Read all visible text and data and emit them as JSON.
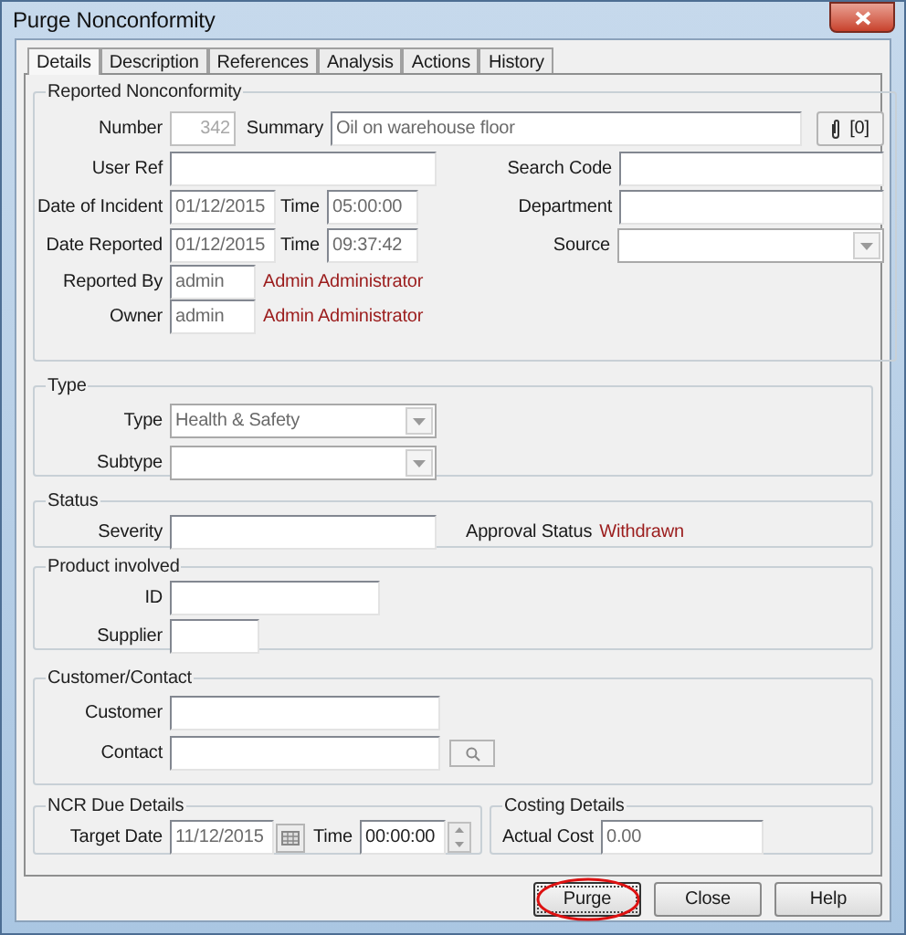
{
  "window": {
    "title": "Purge Nonconformity"
  },
  "tabs": [
    {
      "label": "Details",
      "selected": true
    },
    {
      "label": "Description",
      "selected": false
    },
    {
      "label": "References",
      "selected": false
    },
    {
      "label": "Analysis",
      "selected": false
    },
    {
      "label": "Actions",
      "selected": false
    },
    {
      "label": "History",
      "selected": false
    }
  ],
  "reported": {
    "legend": "Reported Nonconformity",
    "number": {
      "label": "Number",
      "value": "342"
    },
    "summary": {
      "label": "Summary",
      "value": "Oil on warehouse floor"
    },
    "attachments": "[0]",
    "user_ref": {
      "label": "User Ref"
    },
    "search_code": {
      "label": "Search Code"
    },
    "date_of_incident": {
      "label": "Date of Incident",
      "value": "01/12/2015"
    },
    "incident_time": {
      "label": "Time",
      "value": "05:00:00"
    },
    "department": {
      "label": "Department"
    },
    "date_reported": {
      "label": "Date Reported",
      "value": "01/12/2015"
    },
    "reported_time": {
      "label": "Time",
      "value": "09:37:42"
    },
    "source": {
      "label": "Source"
    },
    "reported_by": {
      "label": "Reported By",
      "value": "admin",
      "full_name": "Admin Administrator"
    },
    "owner": {
      "label": "Owner",
      "value": "admin",
      "full_name": "Admin Administrator"
    }
  },
  "type": {
    "legend": "Type",
    "type": {
      "label": "Type",
      "value": "Health & Safety"
    },
    "subtype": {
      "label": "Subtype"
    }
  },
  "status": {
    "legend": "Status",
    "severity": {
      "label": "Severity"
    },
    "approval_status": {
      "label": "Approval Status",
      "value": "Withdrawn"
    }
  },
  "product": {
    "legend": "Product involved",
    "id": {
      "label": "ID"
    },
    "supplier": {
      "label": "Supplier"
    }
  },
  "customer_contact": {
    "legend": "Customer/Contact",
    "customer": {
      "label": "Customer"
    },
    "contact": {
      "label": "Contact"
    }
  },
  "ncr_due": {
    "legend": "NCR Due Details",
    "target_date": {
      "label": "Target Date",
      "value": "11/12/2015"
    },
    "time": {
      "label": "Time",
      "value": "00:00:00"
    }
  },
  "costing": {
    "legend": "Costing Details",
    "actual_cost": {
      "label": "Actual Cost",
      "value": "0.00"
    }
  },
  "buttons": [
    {
      "label": "Purge",
      "highlighted": true
    },
    {
      "label": "Close",
      "highlighted": false
    },
    {
      "label": "Help",
      "highlighted": false
    }
  ]
}
